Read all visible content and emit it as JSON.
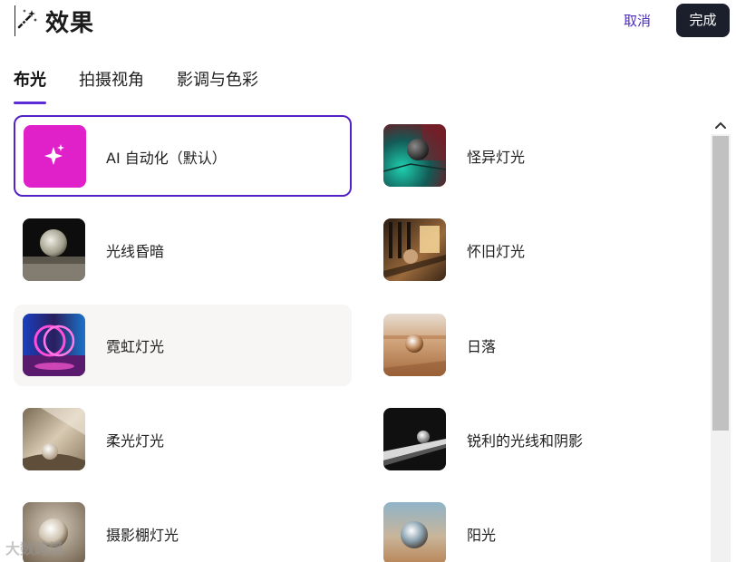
{
  "header": {
    "title": "效果",
    "title_icon": "magic-wand-icon",
    "cancel_label": "取消",
    "done_label": "完成"
  },
  "tabs": [
    {
      "label": "布光",
      "active": true
    },
    {
      "label": "拍摄视角",
      "active": false
    },
    {
      "label": "影调与色彩",
      "active": false
    }
  ],
  "effects": [
    {
      "label": "AI 自动化（默认）",
      "state": "selected",
      "thumb": "sparkle-icon"
    },
    {
      "label": "怪异灯光",
      "state": "normal",
      "thumb": "eerie-light-photo"
    },
    {
      "label": "光线昏暗",
      "state": "normal",
      "thumb": "dim-light-photo"
    },
    {
      "label": "怀旧灯光",
      "state": "normal",
      "thumb": "vintage-light-photo"
    },
    {
      "label": "霓虹灯光",
      "state": "hover",
      "thumb": "neon-light-photo"
    },
    {
      "label": "日落",
      "state": "normal",
      "thumb": "sunset-photo"
    },
    {
      "label": "柔光灯光",
      "state": "normal",
      "thumb": "soft-light-photo"
    },
    {
      "label": "锐利的光线和阴影",
      "state": "normal",
      "thumb": "hard-shadow-photo"
    },
    {
      "label": "摄影棚灯光",
      "state": "normal",
      "thumb": "studio-light-photo"
    },
    {
      "label": "阳光",
      "state": "normal",
      "thumb": "sunlight-photo"
    }
  ],
  "watermark": "大数跨境",
  "colors": {
    "accent": "#5421c7",
    "cancel_text": "#4b2dbd",
    "done_bg": "#1b1f2b",
    "ai_tile": "#e021c9"
  }
}
